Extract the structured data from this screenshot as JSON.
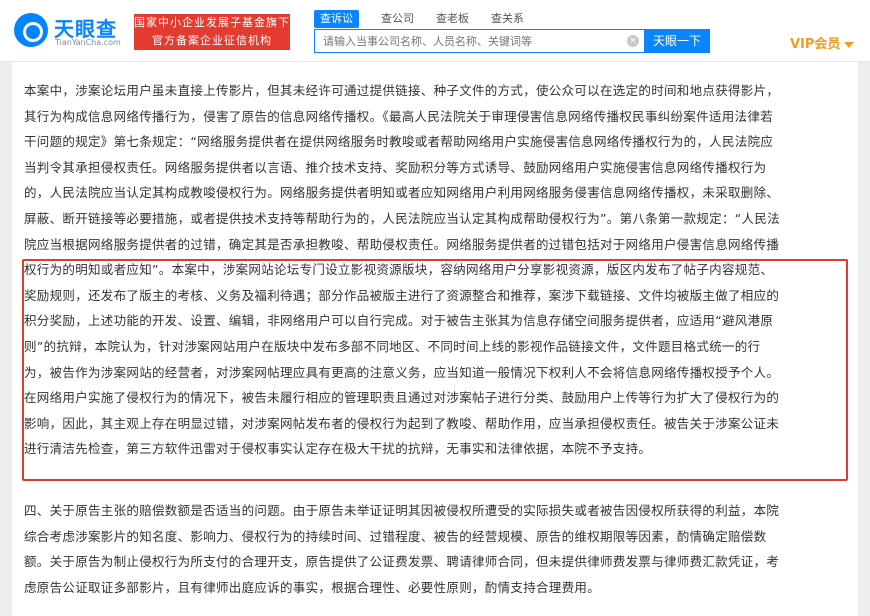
{
  "header": {
    "logo_cn": "天眼查",
    "logo_en": "TianYanCha.com",
    "slogan_line1": "国家中小企业发展子基金旗下",
    "slogan_line2": "官方备案企业征信机构",
    "tabs": [
      "查诉讼",
      "查公司",
      "查老板",
      "查关系"
    ],
    "active_tab": 0,
    "search_placeholder": "请输入当事公司名称、人员名称、关键词等",
    "search_button": "天眼一下",
    "vip_label": "VIP会员"
  },
  "document": {
    "paragraph1_lines": [
      "本案中，涉案论坛用户虽未直接上传影片，但其未经许可通过提供链接、种子文件的方式，使公众可以在选定的时间和地点获得影片，",
      "其行为构成信息网络传播行为，侵害了原告的信息网络传播权。《最高人民法院关于审理侵害信息网络传播权民事纠纷案件适用法律若",
      "干问题的规定》第七条规定：“网络服务提供者在提供网络服务时教唆或者帮助网络用户实施侵害信息网络传播权行为的，人民法院应",
      "当判令其承担侵权责任。网络服务提供者以言语、推介技术支持、奖励积分等方式诱导、鼓励网络用户实施侵害信息网络传播权行为",
      "的，人民法院应当认定其构成教唆侵权行为。网络服务提供者明知或者应知网络用户利用网络服务侵害信息网络传播权，未采取删除、",
      "屏蔽、断开链接等必要措施，或者提供技术支持等帮助行为的，人民法院应当认定其构成帮助侵权行为”。第八条第一款规定：“人民法",
      "院应当根据网络服务提供者的过错，确定其是否承担教唆、帮助侵权责任。网络服务提供者的过错包括对于网络用户侵害信息网络传播",
      "权行为的明知或者应知”。本案中，涉案网站论坛专门设立影视资源版块，容纳网络用户分享影视资源，版区内发布了帖子内容规范、",
      "奖励规则，还发布了版主的考核、义务及福利待遇；部分作品被版主进行了资源整合和推荐，案涉下载链接、文件均被版主做了相应的",
      "积分奖励，上述功能的开发、设置、编辑，非网络用户可以自行完成。对于被告主张其为信息存储空间服务提供者，应适用“避风港原",
      "则”的抗辩，本院认为，针对涉案网站用户在版块中发布多部不同地区、不同时间上线的影视作品链接文件，文件题目格式统一的行",
      "为，被告作为涉案网站的经营者，对涉案网帖理应具有更高的注意义务，应当知道一般情况下权利人不会将信息网络传播权授予个人。",
      "在网络用户实施了侵权行为的情况下，被告未履行相应的管理职责且通过对涉案帖子进行分类、鼓励用户上传等行为扩大了侵权行为的",
      "影响，因此，其主观上存在明显过错，对涉案网帖发布者的侵权行为起到了教唆、帮助作用，应当承担侵权责任。被告关于涉案公证未",
      "进行清洁先检查，第三方软件迅雷对于侵权事实认定存在极大干扰的抗辩，无事实和法律依据，本院不予支持。"
    ],
    "paragraph2_lines": [
      "四、关于原告主张的赔偿数额是否适当的问题。由于原告未举证证明其因被侵权所遭受的实际损失或者被告因侵权所获得的利益，本院",
      "综合考虑涉案影片的知名度、影响力、侵权行为的持续时间、过错程度、被告的经营规模、原告的维权期限等因素，酌情确定赔偿数",
      "额。关于原告为制止侵权行为所支付的合理开支，原告提供了公证费发票、聘请律师合同，但未提供律师费发票与律师费汇款凭证，考",
      "虑原告公证取证多部影片，且有律师出庭应诉的事实，根据合理性、必要性原则，酌情支持合理费用。"
    ]
  },
  "colors": {
    "brand_blue": "#0a84ff",
    "slogan_red": "#e33b2f",
    "highlight_red": "#e03b2f",
    "vip_orange": "#f59b1c",
    "text": "#333333"
  }
}
